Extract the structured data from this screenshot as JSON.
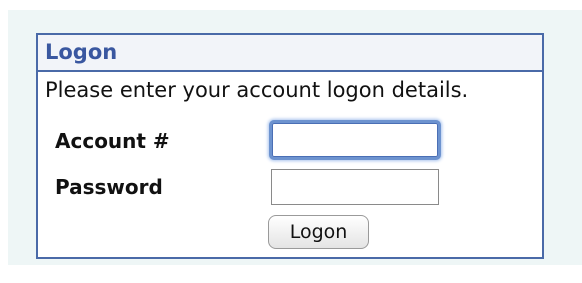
{
  "logon_panel": {
    "title": "Logon",
    "instructions": "Please enter your account logon details.",
    "account_label": "Account #",
    "account_value": "",
    "password_label": "Password",
    "password_value": "",
    "button_label": "Logon"
  },
  "colors": {
    "panel_border": "#4a6aa8",
    "title_text": "#3a57a0",
    "page_background": "#eef6f6",
    "focus_ring": "#6d93cf"
  }
}
